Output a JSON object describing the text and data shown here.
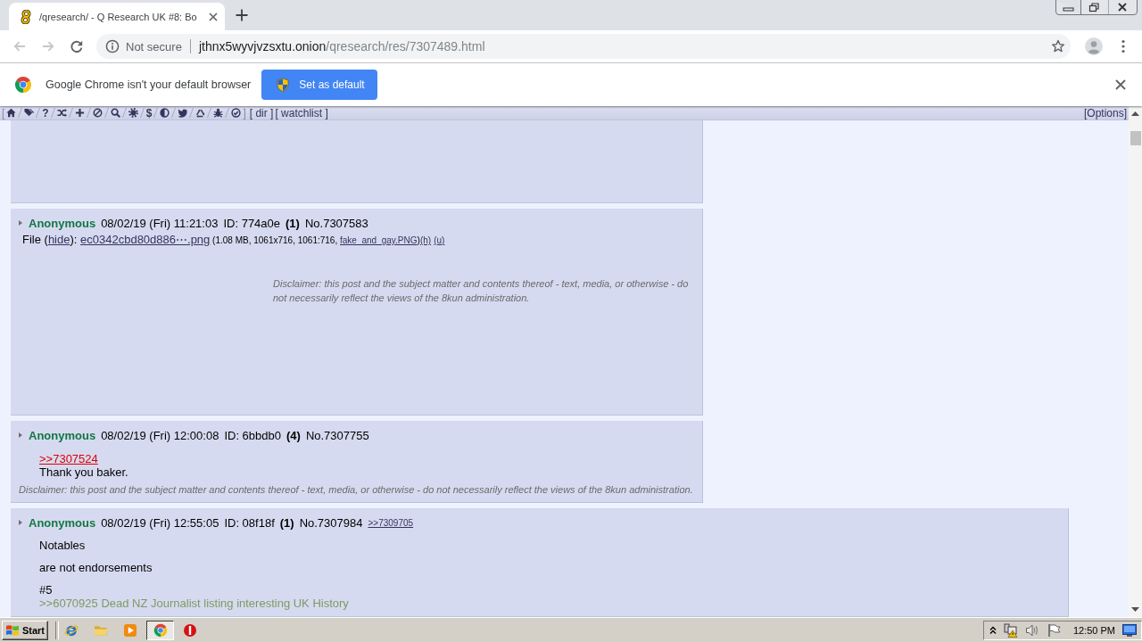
{
  "browser": {
    "tab": {
      "title": "/qresearch/ - Q Research UK #8: Bo",
      "selected": true
    },
    "back_button": {
      "disabled": true
    },
    "forward_button": {
      "disabled": true
    },
    "address_bar": {
      "security": "Not secure",
      "host": "jthnx5wyvjvzsxtu.onion",
      "path": "/qresearch/res/7307489.html"
    },
    "infobar": {
      "message": "Google Chrome isn't your default browser",
      "button": "Set as default"
    }
  },
  "board_toolbar": {
    "open_bracket": "[",
    "items": [
      {
        "kind": "icon"
      },
      {
        "kind": "icon"
      },
      {
        "kind": "glyph",
        "text": "?"
      },
      {
        "kind": "icon"
      },
      {
        "kind": "icon"
      },
      {
        "kind": "icon"
      },
      {
        "kind": "icon"
      },
      {
        "kind": "icon"
      },
      {
        "kind": "glyph",
        "text": "$"
      },
      {
        "kind": "icon"
      },
      {
        "kind": "icon"
      },
      {
        "kind": "icon"
      },
      {
        "kind": "icon"
      },
      {
        "kind": "icon"
      }
    ],
    "close_bracket": "]",
    "links": [
      "[ dir ]",
      "[ watchlist ]"
    ],
    "options": "[Options]"
  },
  "posts": [
    {
      "kind": "blank"
    },
    {
      "kind": "file_post",
      "name": "Anonymous",
      "date": "08/02/19 (Fri) 11:21:03",
      "id": "ID: 774a0e",
      "id_posts": "(1)",
      "number": "No.7307583",
      "file": [
        {
          "kind": "text",
          "text": "File ("
        },
        {
          "kind": "link",
          "text": "hide"
        },
        {
          "kind": "text",
          "text": "): "
        },
        {
          "kind": "link",
          "text": "ec0342cbd80d886⋯.png"
        },
        {
          "kind": "small",
          "text": " (1.08 MB, 1061x716, 1061:716, "
        },
        {
          "kind": "small_link",
          "text": "fake_and_gay.PNG"
        },
        {
          "kind": "small",
          "text": ")"
        },
        {
          "kind": "small_link",
          "text": "(h)"
        },
        {
          "kind": "small_link",
          "text": "(u)"
        }
      ],
      "disclaimer": "Disclaimer: this post and the subject matter and contents thereof - text, media, or otherwise - do not necessarily reflect the views of the 8kun administration."
    },
    {
      "kind": "text_post",
      "name": "Anonymous",
      "date": "08/02/19 (Fri) 12:00:08",
      "id": "ID: 6bbdb0",
      "id_posts": "(4)",
      "number": "No.7307755",
      "paragraphs": [
        {
          "lines": [
            {
              "kind": "reply_link",
              "text": ">>7307524"
            },
            {
              "kind": "text",
              "text": "Thank you baker."
            }
          ]
        }
      ],
      "disclaimer": "Disclaimer: this post and the subject matter and contents thereof - text, media, or otherwise - do not necessarily reflect the views of the 8kun administration."
    },
    {
      "kind": "text_post",
      "name": "Anonymous",
      "date": "08/02/19 (Fri) 12:55:05",
      "id": "ID: 08f18f",
      "id_posts": "(1)",
      "number": "No.7307984",
      "backlinks": [
        ">>7309705"
      ],
      "paragraphs": [
        {
          "lines": [
            {
              "kind": "text",
              "text": "Notables"
            }
          ]
        },
        {
          "lines": [
            {
              "kind": "text",
              "text": "are not endorsements"
            }
          ]
        },
        {
          "lines": [
            {
              "kind": "text",
              "text": "#5"
            },
            {
              "kind": "cross_link",
              "text": ">>6070925 Dead NZ Journalist listing interesting UK History"
            }
          ]
        }
      ]
    }
  ],
  "taskbar": {
    "start": "Start",
    "task_buttons": [
      {
        "selected": true
      },
      {
        "selected": false
      }
    ],
    "clock": "12:50 PM"
  }
}
